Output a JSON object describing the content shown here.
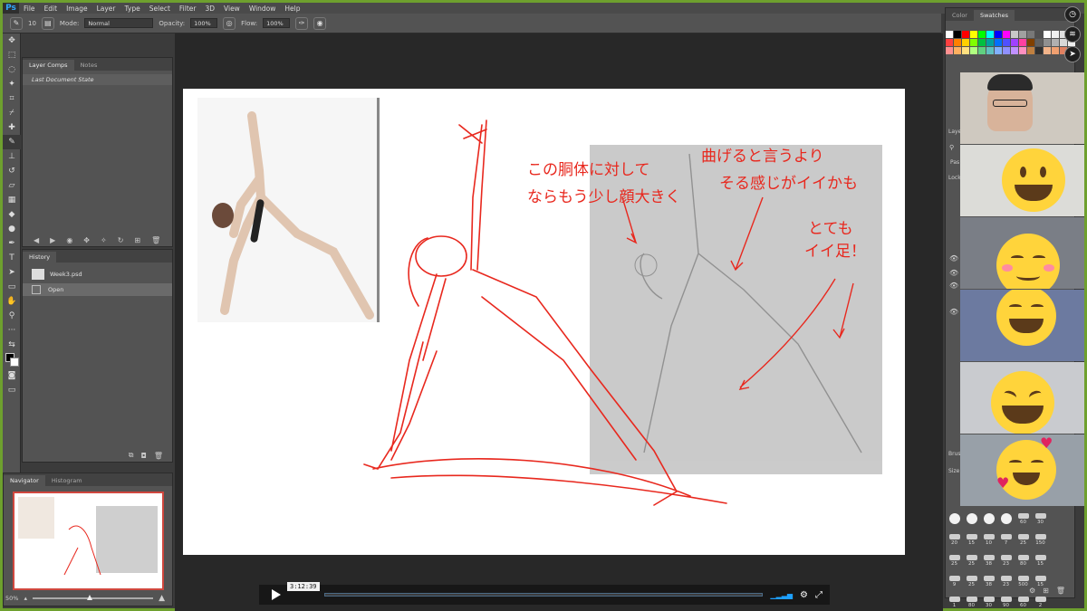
{
  "app": {
    "logo": "Ps"
  },
  "menu": [
    "File",
    "Edit",
    "Image",
    "Layer",
    "Type",
    "Select",
    "Filter",
    "3D",
    "View",
    "Window",
    "Help"
  ],
  "options": {
    "brush_size": "10",
    "mode_label": "Mode:",
    "mode_value": "Normal",
    "opacity_label": "Opacity:",
    "opacity_value": "100%",
    "flow_label": "Flow:",
    "flow_value": "100%"
  },
  "layer_comps": {
    "tabs": [
      "Layer Comps",
      "Notes"
    ],
    "row": "Last Document State"
  },
  "history": {
    "tab": "History",
    "snapshot": "Week3.psd",
    "items": [
      "Open"
    ]
  },
  "navigator": {
    "tabs": [
      "Navigator",
      "Histogram"
    ],
    "zoom": "50%"
  },
  "right_panel": {
    "tabs": [
      "Color",
      "Swatches"
    ],
    "layers_label": "Laye",
    "pass_label": "Pas",
    "lock_label": "Lock:",
    "brush_label": "Brus",
    "size_label": "Size:",
    "swatch_colors": [
      "#ffffff",
      "#000000",
      "#ff0000",
      "#ffff00",
      "#00ff00",
      "#00ffff",
      "#0000ff",
      "#ff00ff",
      "#c8c8c8",
      "#a0a0a0",
      "#787878",
      "#505050",
      "#ffffff",
      "#f0f0f0",
      "#e0e0e0",
      "#d0d0d0",
      "#ff4040",
      "#ff8000",
      "#ffd000",
      "#80ff00",
      "#00c040",
      "#00a0a0",
      "#0070ff",
      "#5050ff",
      "#a040ff",
      "#ff40a0",
      "#804000",
      "#606060",
      "#909090",
      "#b0b0b0",
      "#d8d8d8",
      "#eeeeee",
      "#ff9090",
      "#ffb060",
      "#ffe080",
      "#b0ff80",
      "#60d080",
      "#60c0c0",
      "#80b0ff",
      "#9090ff",
      "#c090ff",
      "#ff90c0",
      "#c08040",
      "#303030",
      "#f2b48a",
      "#f0a070",
      "#e08060",
      "#c86040"
    ],
    "brush_sizes": [
      "",
      "",
      "",
      "",
      "60",
      "30",
      "20",
      "15",
      "10",
      "7",
      "25",
      "150",
      "25",
      "25",
      "38",
      "23",
      "80",
      "15",
      "9",
      "25",
      "38",
      "23",
      "500",
      "15",
      "1",
      "80",
      "30",
      "90",
      "60",
      "2"
    ]
  },
  "sketch_notes": {
    "note1_line1": "この胴体に対して",
    "note1_line2": "ならもう少し顔大きく",
    "note2_line1": "曲げると言うより",
    "note2_line2": "そる感じがイイかも",
    "note3_line1": "とても",
    "note3_line2": "イイ足！"
  },
  "player": {
    "time": "3:12:39"
  },
  "colors": {
    "accent_green": "#6ea02e",
    "stroke_red": "#e8281e",
    "emoji_yellow": "#ffd43b"
  }
}
